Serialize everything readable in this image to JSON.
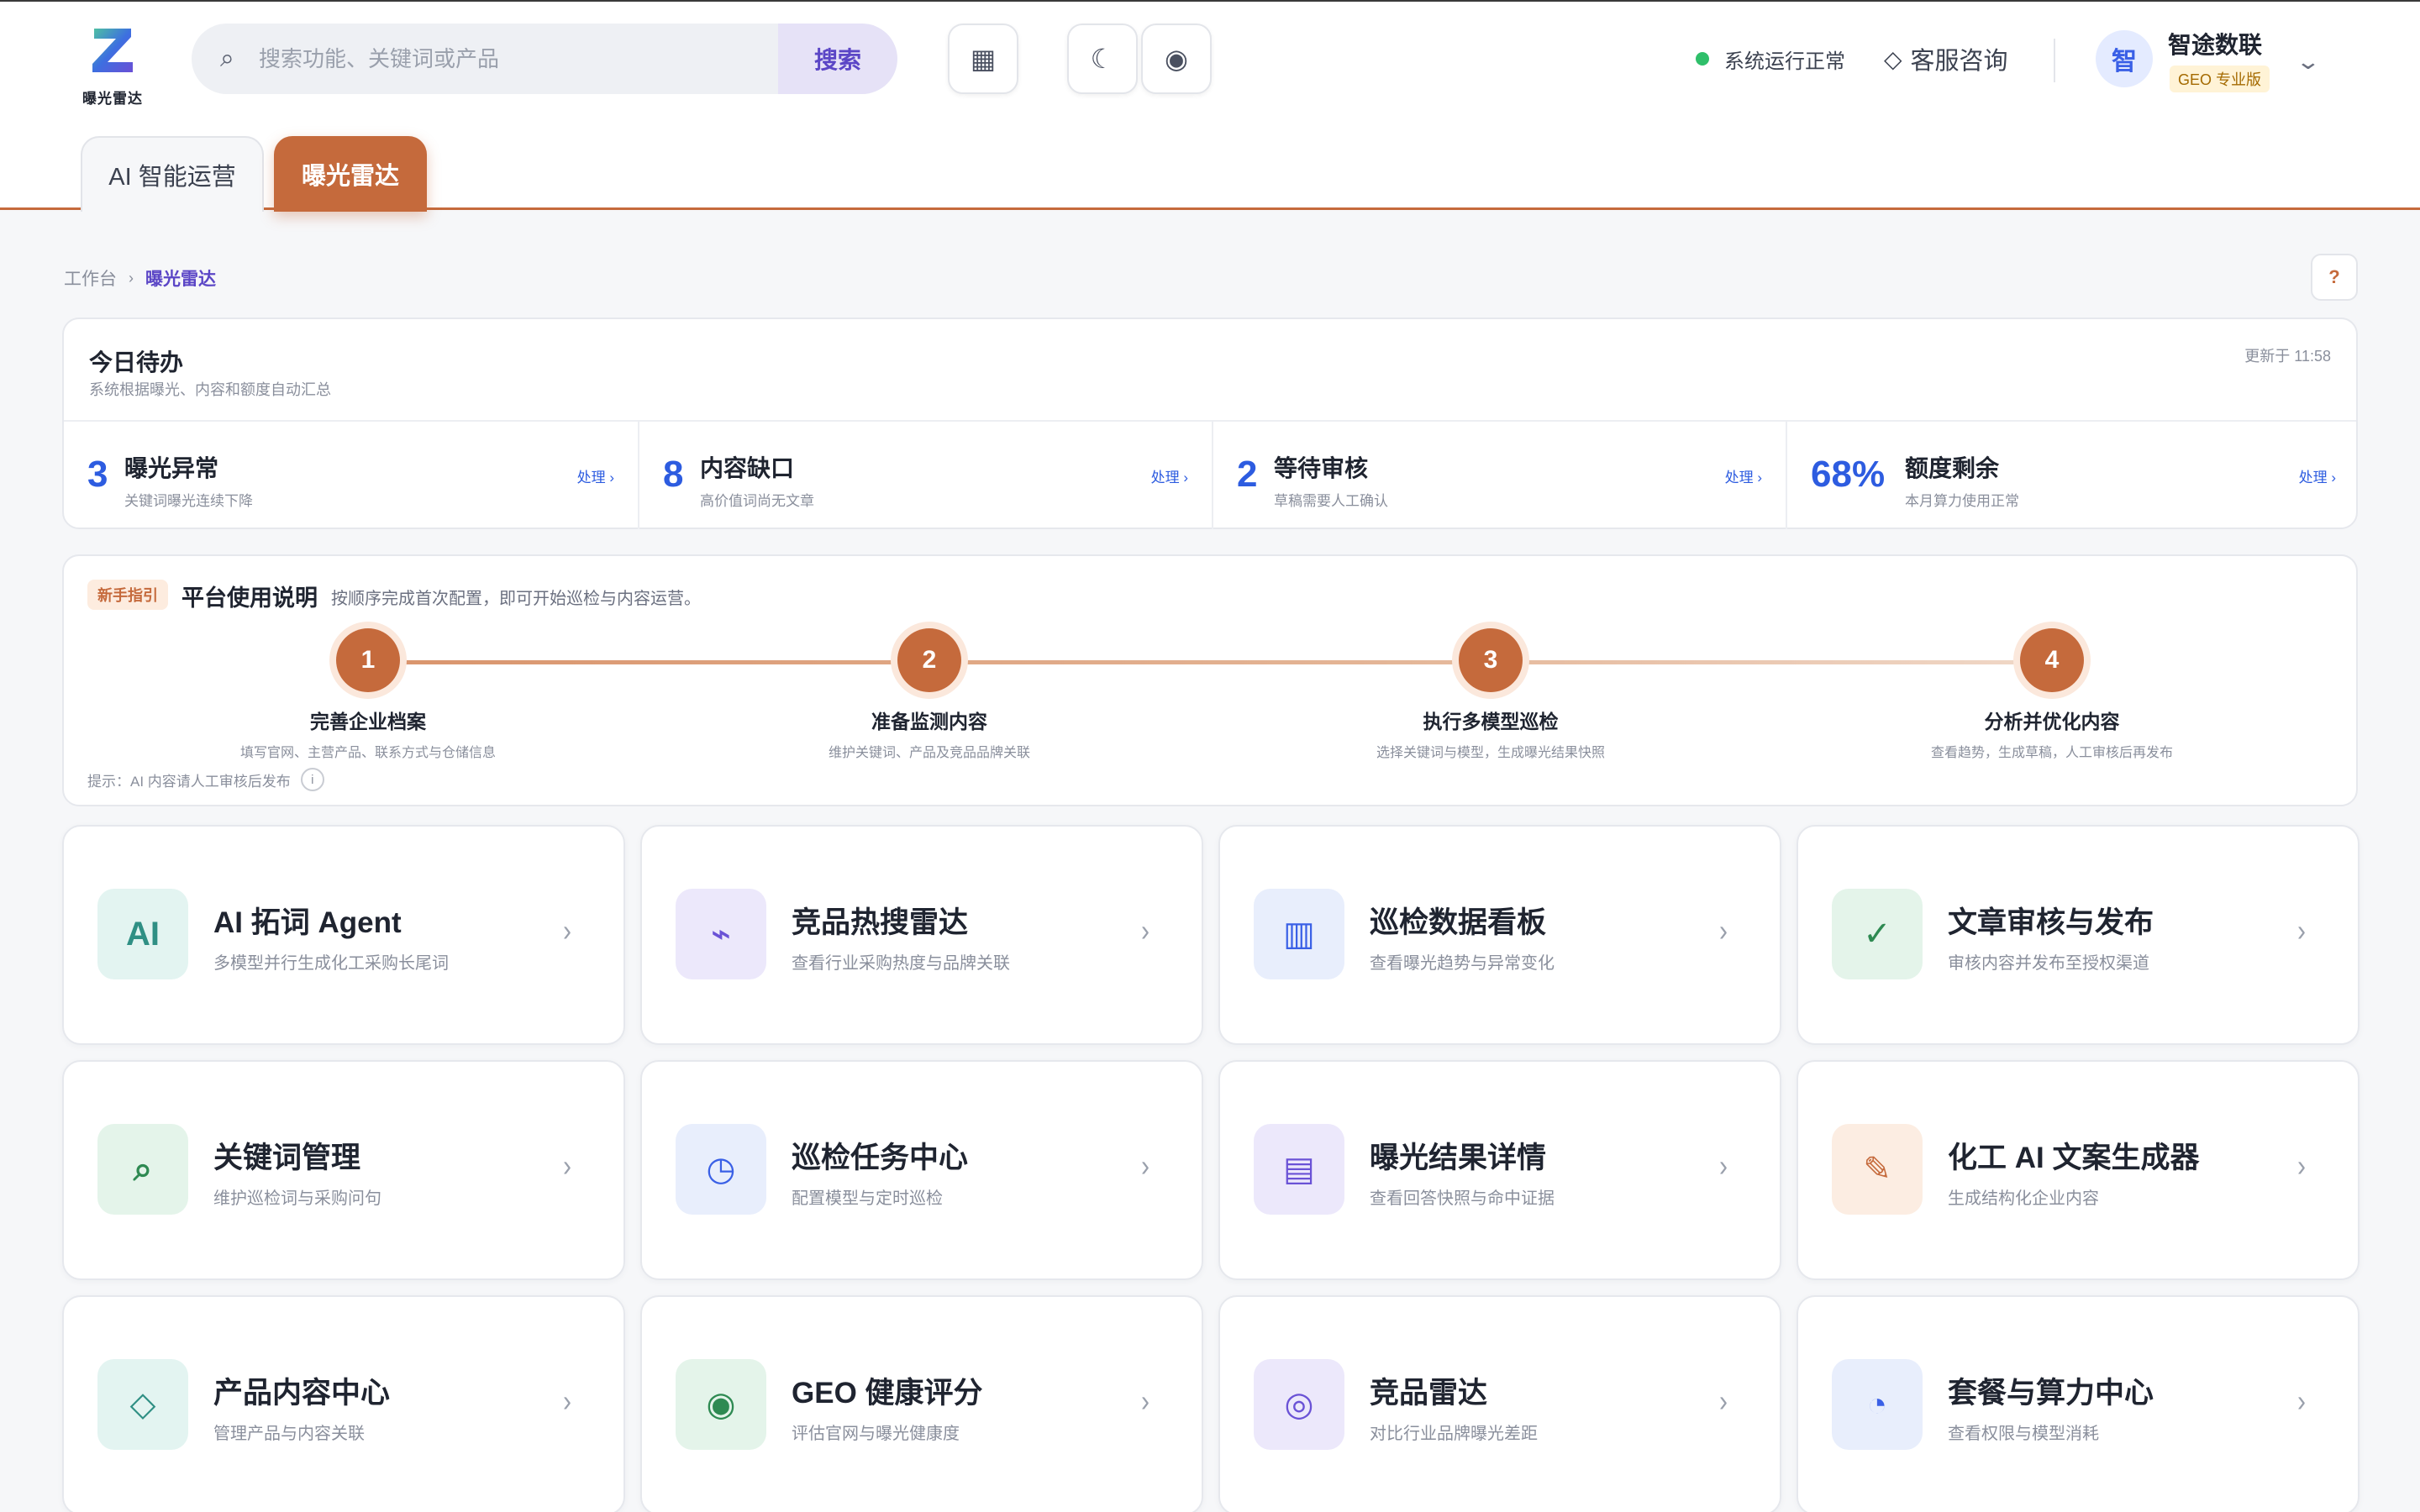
{
  "logo": {
    "text": "曝光雷达"
  },
  "search": {
    "placeholder": "搜索功能、关键词或产品",
    "button_label": "搜索",
    "icon": "⌕"
  },
  "toolbar": {
    "grid_icon": "▦",
    "theme_icon": "☾",
    "record_icon": "◉"
  },
  "status": {
    "text": "系统运行正常",
    "color": "#2fbf6a"
  },
  "support": {
    "icon": "◇",
    "label": "客服咨询"
  },
  "user": {
    "avatar": "智",
    "org_name": "智途数联",
    "plan_badge": "GEO 专业版",
    "chevron": "⌄"
  },
  "tabs": [
    {
      "label": "AI 智能运营",
      "active": false
    },
    {
      "label": "曝光雷达",
      "active": true
    }
  ],
  "breadcrumb": {
    "root": "工作台",
    "sep": "›",
    "current": "曝光雷达"
  },
  "help_label": "?",
  "todo": {
    "title": "今日待办",
    "subtitle": "系统根据曝光、内容和额度自动汇总",
    "updated": "更新于 11:58",
    "metrics": [
      {
        "value": "3",
        "label": "曝光异常",
        "desc": "关键词曝光连续下降",
        "action": "处理 ›"
      },
      {
        "value": "8",
        "label": "内容缺口",
        "desc": "高价值词尚无文章",
        "action": "处理 ›"
      },
      {
        "value": "2",
        "label": "等待审核",
        "desc": "草稿需要人工确认",
        "action": "处理 ›"
      },
      {
        "value": "68%",
        "label": "额度剩余",
        "desc": "本月算力使用正常",
        "action": "处理 ›"
      }
    ]
  },
  "guide": {
    "badge": "新手指引",
    "title": "平台使用说明",
    "subtitle": "按顺序完成首次配置，即可开始巡检与内容运营。",
    "steps": [
      {
        "num": "1",
        "title": "完善企业档案",
        "desc": "填写官网、主营产品、联系方式与仓储信息"
      },
      {
        "num": "2",
        "title": "准备监测内容",
        "desc": "维护关键词、产品及竞品品牌关联"
      },
      {
        "num": "3",
        "title": "执行多模型巡检",
        "desc": "选择关键词与模型，生成曝光结果快照"
      },
      {
        "num": "4",
        "title": "分析并优化内容",
        "desc": "查看趋势，生成草稿，人工审核后再发布"
      }
    ],
    "tip": "提示：AI 内容请人工审核后发布",
    "tip_icon": "i"
  },
  "features": [
    {
      "icon": "AI",
      "title": "AI 拓词 Agent",
      "desc": "多模型并行生成化工采购长尾词",
      "icon_bg": "#e3f4f1",
      "icon_color": "#2f8f84"
    },
    {
      "icon": "⌁",
      "title": "竞品热搜雷达",
      "desc": "查看行业采购热度与品牌关联",
      "icon_bg": "#ece8fb",
      "icon_color": "#6a52d6"
    },
    {
      "icon": "▥",
      "title": "巡检数据看板",
      "desc": "查看曝光趋势与异常变化",
      "icon_bg": "#e8eefc",
      "icon_color": "#3a60e6"
    },
    {
      "icon": "✓",
      "title": "文章审核与发布",
      "desc": "审核内容并发布至授权渠道",
      "icon_bg": "#e4f4ea",
      "icon_color": "#2e8a52"
    },
    {
      "icon": "⌕",
      "title": "关键词管理",
      "desc": "维护巡检词与采购问句",
      "icon_bg": "#e4f4ea",
      "icon_color": "#2e8a52"
    },
    {
      "icon": "◷",
      "title": "巡检任务中心",
      "desc": "配置模型与定时巡检",
      "icon_bg": "#e8eefc",
      "icon_color": "#3a60e6"
    },
    {
      "icon": "▤",
      "title": "曝光结果详情",
      "desc": "查看回答快照与命中证据",
      "icon_bg": "#ece8fb",
      "icon_color": "#6a52d6"
    },
    {
      "icon": "✎",
      "title": "化工 AI 文案生成器",
      "desc": "生成结构化企业内容",
      "icon_bg": "#fcede2",
      "icon_color": "#c56a3c"
    },
    {
      "icon": "◇",
      "title": "产品内容中心",
      "desc": "管理产品与内容关联",
      "icon_bg": "#e3f4f1",
      "icon_color": "#2f8f84"
    },
    {
      "icon": "◉",
      "title": "GEO 健康评分",
      "desc": "评估官网与曝光健康度",
      "icon_bg": "#e4f4ea",
      "icon_color": "#2e8a52"
    },
    {
      "icon": "◎",
      "title": "竞品雷达",
      "desc": "对比行业品牌曝光差距",
      "icon_bg": "#ece8fb",
      "icon_color": "#6a52d6"
    },
    {
      "icon": "◔",
      "title": "套餐与算力中心",
      "desc": "查看权限与模型消耗",
      "icon_bg": "#e8eefc",
      "icon_color": "#3a60e6"
    }
  ],
  "feature_arrow": "›",
  "colors": {
    "accent": "#c56a3c",
    "primary": "#5b46c6",
    "metric": "#2d5ce0"
  }
}
